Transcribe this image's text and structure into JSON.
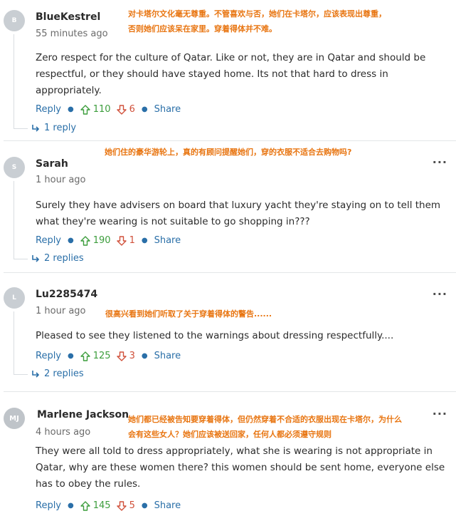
{
  "colors": {
    "link": "#2a6fa8",
    "upvote": "#3c9d3c",
    "downvote": "#d0503a",
    "annotation": "#e87511"
  },
  "comments": [
    {
      "initials": "B",
      "name": "BlueKestrel",
      "time": "55 minutes ago",
      "body": "Zero respect for the culture of Qatar.   Like or not, they are in Qatar and should be respectful, or they should have stayed home.   Its not that hard to dress in appropriately.",
      "reply_label": "Reply",
      "upvotes": "110",
      "downvotes": "6",
      "share_label": "Share",
      "replies": "1 reply",
      "annotation": "对卡塔尔文化毫无尊重。不管喜欢与否，她们在卡塔尔，应该表现出尊重，否则她们应该呆在家里。穿着得体并不难。"
    },
    {
      "initials": "S",
      "name": "Sarah",
      "time": "1 hour ago",
      "body": "Surely they have advisers on board that luxury yacht they're staying on to tell them what they're wearing is not suitable to go shopping in???",
      "reply_label": "Reply",
      "upvotes": "190",
      "downvotes": "1",
      "share_label": "Share",
      "replies": "2 replies",
      "annotation": "她们住的豪华游轮上，真的有顾问提醒她们，穿的衣服不适合去购物吗?"
    },
    {
      "initials": "L",
      "name": "Lu2285474",
      "time": "1 hour ago",
      "body": "Pleased to see they listened to the warnings about dressing respectfully....",
      "reply_label": "Reply",
      "upvotes": "125",
      "downvotes": "3",
      "share_label": "Share",
      "replies": "2 replies",
      "annotation": "很高兴看到她们听取了关于穿着得体的警告......"
    },
    {
      "initials": "MJ",
      "name": "Marlene Jackson",
      "time": "4 hours ago",
      "body": "They were all told to dress appropriately, what she is wearing is not appropriate in Qatar, why are these women there? this women should be sent home, everyone else has to obey the rules.",
      "reply_label": "Reply",
      "upvotes": "145",
      "downvotes": "5",
      "share_label": "Share",
      "annotation": "她们都已经被告知要穿着得体，但仍然穿着不合适的衣服出现在卡塔尔，为什么会有这些女人？她们应该被送回家，任何人都必须遵守规则"
    }
  ]
}
